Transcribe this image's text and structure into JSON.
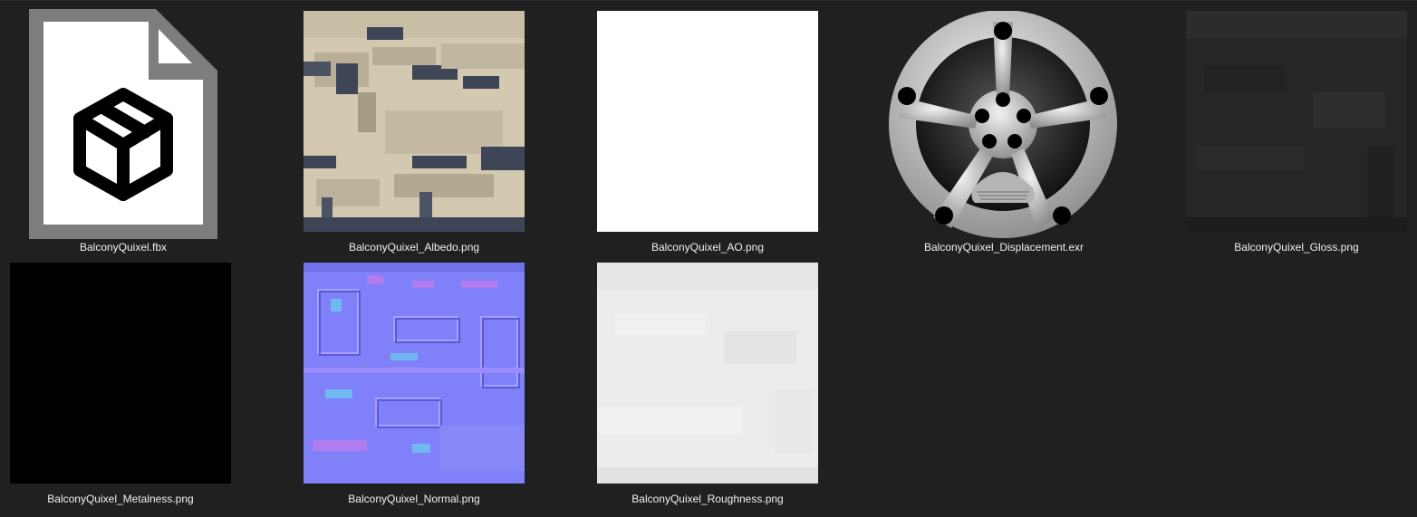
{
  "files": [
    {
      "name": "BalconyQuixel.fbx",
      "icon": "fbx-file-icon"
    },
    {
      "name": "BalconyQuixel_Albedo.png",
      "icon": "albedo-texture-thumbnail"
    },
    {
      "name": "BalconyQuixel_AO.png",
      "icon": "ao-texture-thumbnail"
    },
    {
      "name": "BalconyQuixel_Displacement.exr",
      "icon": "film-reel-icon"
    },
    {
      "name": "BalconyQuixel_Gloss.png",
      "icon": "gloss-texture-thumbnail"
    },
    {
      "name": "BalconyQuixel_Metalness.png",
      "icon": "metalness-texture-thumbnail"
    },
    {
      "name": "BalconyQuixel_Normal.png",
      "icon": "normal-map-thumbnail"
    },
    {
      "name": "BalconyQuixel_Roughness.png",
      "icon": "roughness-texture-thumbnail"
    }
  ],
  "colors": {
    "background": "#202020",
    "label_text": "#f0f0f0",
    "albedo_base": "#d3c8b0",
    "albedo_dark": "#3e4556",
    "normal_base": "#8080f8",
    "gloss_base": "#262626",
    "roughness_base": "#ececec"
  }
}
